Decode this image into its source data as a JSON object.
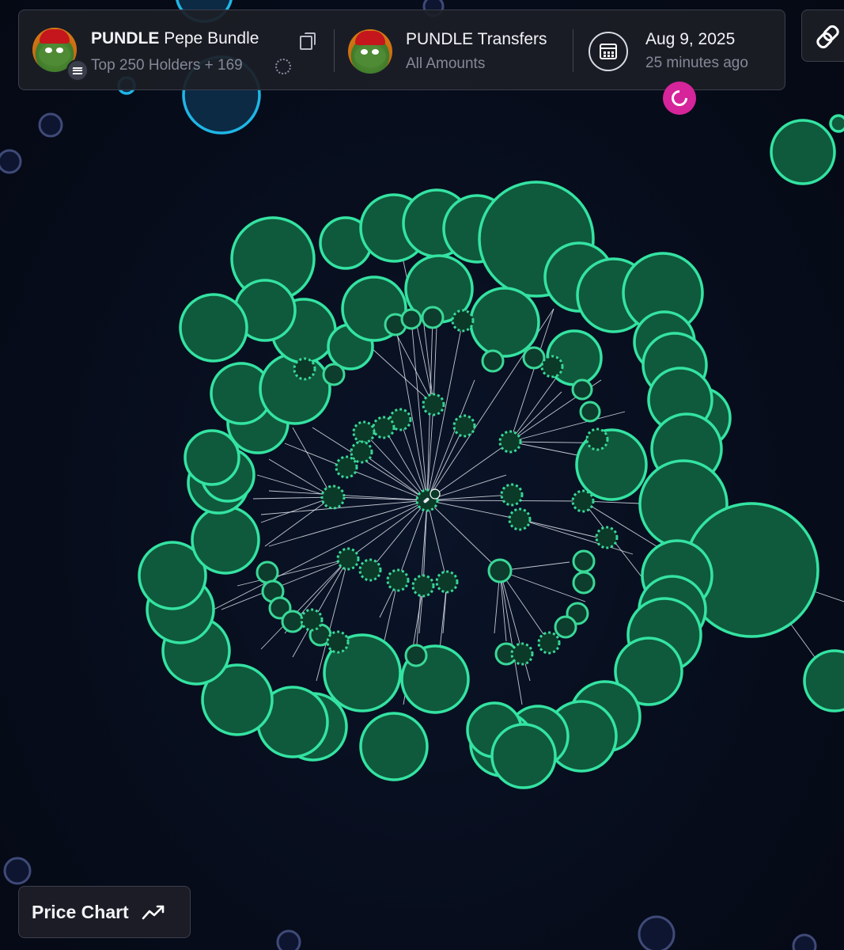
{
  "token": {
    "symbol": "PUNDLE",
    "name": "Pepe Bundle",
    "holders_label": "Top 250 Holders + 169"
  },
  "transfers": {
    "title": "PUNDLE Transfers",
    "filter": "All Amounts"
  },
  "date": {
    "value": "Aug 9, 2025",
    "relative": "25 minutes ago"
  },
  "price_chart": {
    "label": "Price Chart"
  },
  "icons": {
    "copy": "copy-icon",
    "spinner": "loading-icon",
    "calendar": "calendar-icon",
    "refresh": "refresh-icon",
    "link": "link-icon",
    "chart": "trend-line-icon",
    "chain": "solana-icon",
    "lock": "lock-icon"
  },
  "colors": {
    "accent_green": "#34e3a2",
    "node_fill": "#0f5a3c",
    "refresh_pink": "#d6249a",
    "background": "#070d1c"
  }
}
